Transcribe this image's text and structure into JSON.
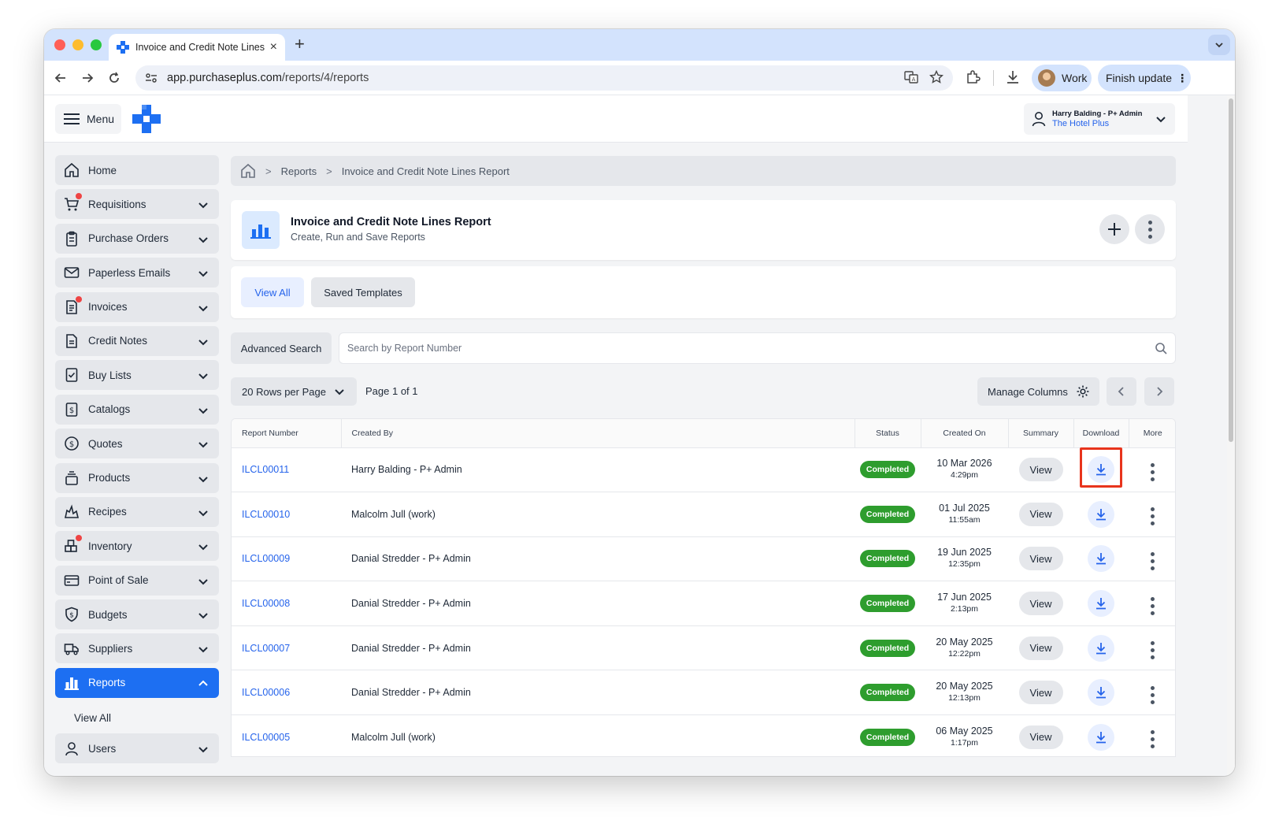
{
  "browser": {
    "tab_title": "Invoice and Credit Note Lines",
    "tab_close": "×",
    "new_tab": "+",
    "url_host": "app.purchaseplus.com",
    "url_path": "/reports/4/reports",
    "profile_label": "Work",
    "finish_update_label": "Finish update"
  },
  "header": {
    "menu_label": "Menu",
    "user_name": "Harry Balding - P+ Admin",
    "organisation": "The Hotel Plus"
  },
  "sidebar": {
    "items": [
      {
        "label": "Home",
        "icon": "home-icon",
        "has_caret": false,
        "notification": false
      },
      {
        "label": "Requisitions",
        "icon": "cart-icon",
        "has_caret": true,
        "notification": true
      },
      {
        "label": "Purchase Orders",
        "icon": "clipboard-icon",
        "has_caret": true,
        "notification": false
      },
      {
        "label": "Paperless Emails",
        "icon": "mail-icon",
        "has_caret": true,
        "notification": false
      },
      {
        "label": "Invoices",
        "icon": "invoice-icon",
        "has_caret": true,
        "notification": true
      },
      {
        "label": "Credit Notes",
        "icon": "document-icon",
        "has_caret": true,
        "notification": false
      },
      {
        "label": "Buy Lists",
        "icon": "checklist-icon",
        "has_caret": true,
        "notification": false
      },
      {
        "label": "Catalogs",
        "icon": "catalog-dollar-icon",
        "has_caret": true,
        "notification": false
      },
      {
        "label": "Quotes",
        "icon": "dollar-circle-icon",
        "has_caret": true,
        "notification": false
      },
      {
        "label": "Products",
        "icon": "stack-icon",
        "has_caret": true,
        "notification": false
      },
      {
        "label": "Recipes",
        "icon": "flame-icon",
        "has_caret": true,
        "notification": false
      },
      {
        "label": "Inventory",
        "icon": "boxes-icon",
        "has_caret": true,
        "notification": true
      },
      {
        "label": "Point of Sale",
        "icon": "credit-card-icon",
        "has_caret": true,
        "notification": false
      },
      {
        "label": "Budgets",
        "icon": "shield-dollar-icon",
        "has_caret": true,
        "notification": false
      },
      {
        "label": "Suppliers",
        "icon": "truck-icon",
        "has_caret": true,
        "notification": false
      },
      {
        "label": "Reports",
        "icon": "bar-chart-icon",
        "has_caret": true,
        "notification": false,
        "active": true
      }
    ],
    "sub_items": [
      "View All"
    ],
    "partial_item": "Users"
  },
  "breadcrumb": {
    "items": [
      "Reports",
      "Invoice and Credit Note Lines Report"
    ]
  },
  "report": {
    "title": "Invoice and Credit Note Lines Report",
    "subtitle": "Create, Run and Save Reports"
  },
  "tabs": {
    "view_all": "View All",
    "saved_templates": "Saved Templates"
  },
  "search": {
    "advanced_label": "Advanced Search",
    "placeholder": "Search by Report Number"
  },
  "pager": {
    "rows_per_page": "20 Rows per Page",
    "page_info": "Page 1 of 1",
    "manage_columns": "Manage Columns"
  },
  "table": {
    "columns": [
      "Report Number",
      "Created By",
      "Status",
      "Created On",
      "Summary",
      "Download",
      "More"
    ],
    "view_label": "View",
    "rows": [
      {
        "number": "ILCL00011",
        "created_by": "Harry Balding - P+ Admin",
        "status": "Completed",
        "date": "10 Mar 2026",
        "time": "4:29pm"
      },
      {
        "number": "ILCL00010",
        "created_by": "Malcolm Jull (work)",
        "status": "Completed",
        "date": "01 Jul 2025",
        "time": "11:55am"
      },
      {
        "number": "ILCL00009",
        "created_by": "Danial Stredder - P+ Admin",
        "status": "Completed",
        "date": "19 Jun 2025",
        "time": "12:35pm"
      },
      {
        "number": "ILCL00008",
        "created_by": "Danial Stredder - P+ Admin",
        "status": "Completed",
        "date": "17 Jun 2025",
        "time": "2:13pm"
      },
      {
        "number": "ILCL00007",
        "created_by": "Danial Stredder - P+ Admin",
        "status": "Completed",
        "date": "20 May 2025",
        "time": "12:22pm"
      },
      {
        "number": "ILCL00006",
        "created_by": "Danial Stredder - P+ Admin",
        "status": "Completed",
        "date": "20 May 2025",
        "time": "12:13pm"
      },
      {
        "number": "ILCL00005",
        "created_by": "Malcolm Jull (work)",
        "status": "Completed",
        "date": "06 May 2025",
        "time": "1:17pm"
      }
    ]
  },
  "colors": {
    "accent": "#1d6ff2",
    "link": "#2563eb",
    "status_completed": "#2e9d2e",
    "highlight": "#e8341c"
  }
}
